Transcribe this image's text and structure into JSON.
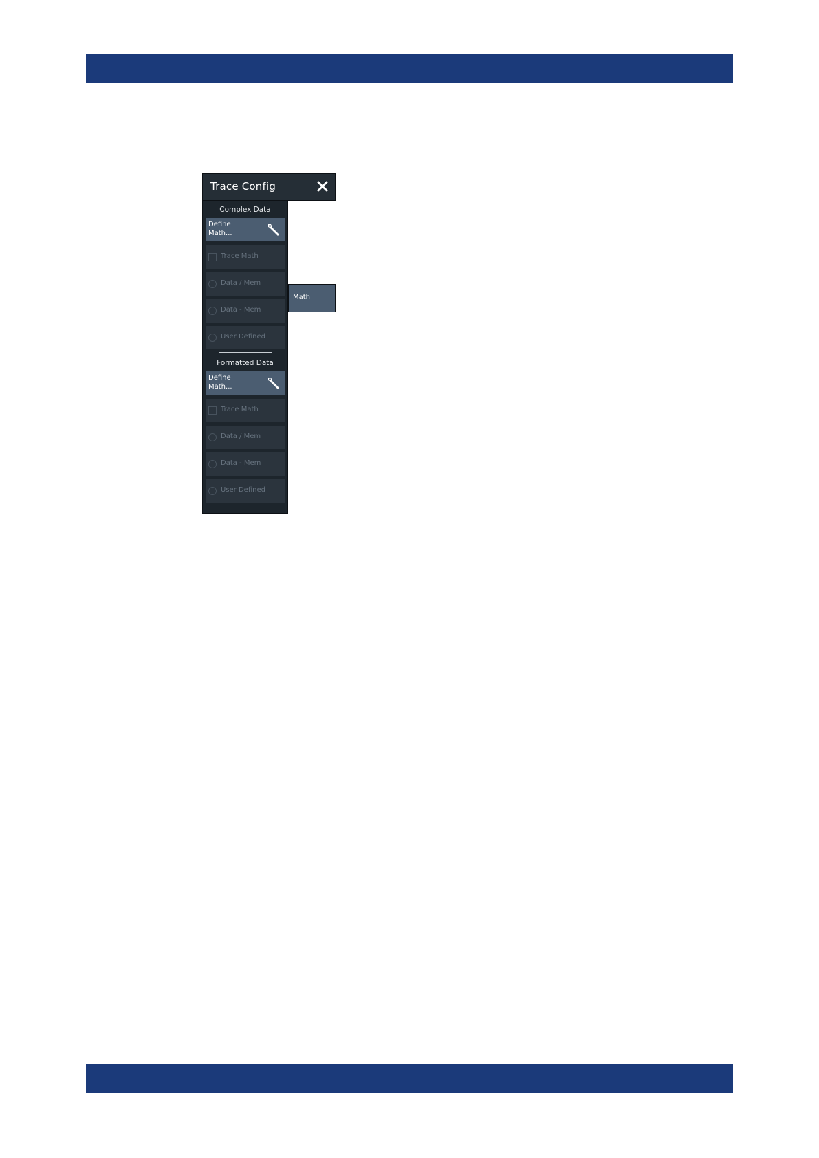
{
  "colors": {
    "header_bar": "#1b3a7a",
    "panel_bg": "#1d252c",
    "button_active": "#4b5d71",
    "button_disabled": "#2b343d",
    "disabled_text": "#66727e"
  },
  "dialog": {
    "title": "Trace Config",
    "close_icon": "close-icon"
  },
  "complex": {
    "heading": "Complex Data",
    "define_label": "Define Math...",
    "define_icon": "wrench-icon",
    "trace_math": "Trace Math",
    "data_div_mem": "Data / Mem",
    "data_minus_mem": "Data - Mem",
    "user_defined": "User Defined"
  },
  "formatted": {
    "heading": "Formatted Data",
    "define_label": "Define Math...",
    "define_icon": "wrench-icon",
    "trace_math": "Trace Math",
    "data_div_mem": "Data / Mem",
    "data_minus_mem": "Data - Mem",
    "user_defined": "User Defined"
  },
  "side_tab": {
    "label": "Math"
  }
}
